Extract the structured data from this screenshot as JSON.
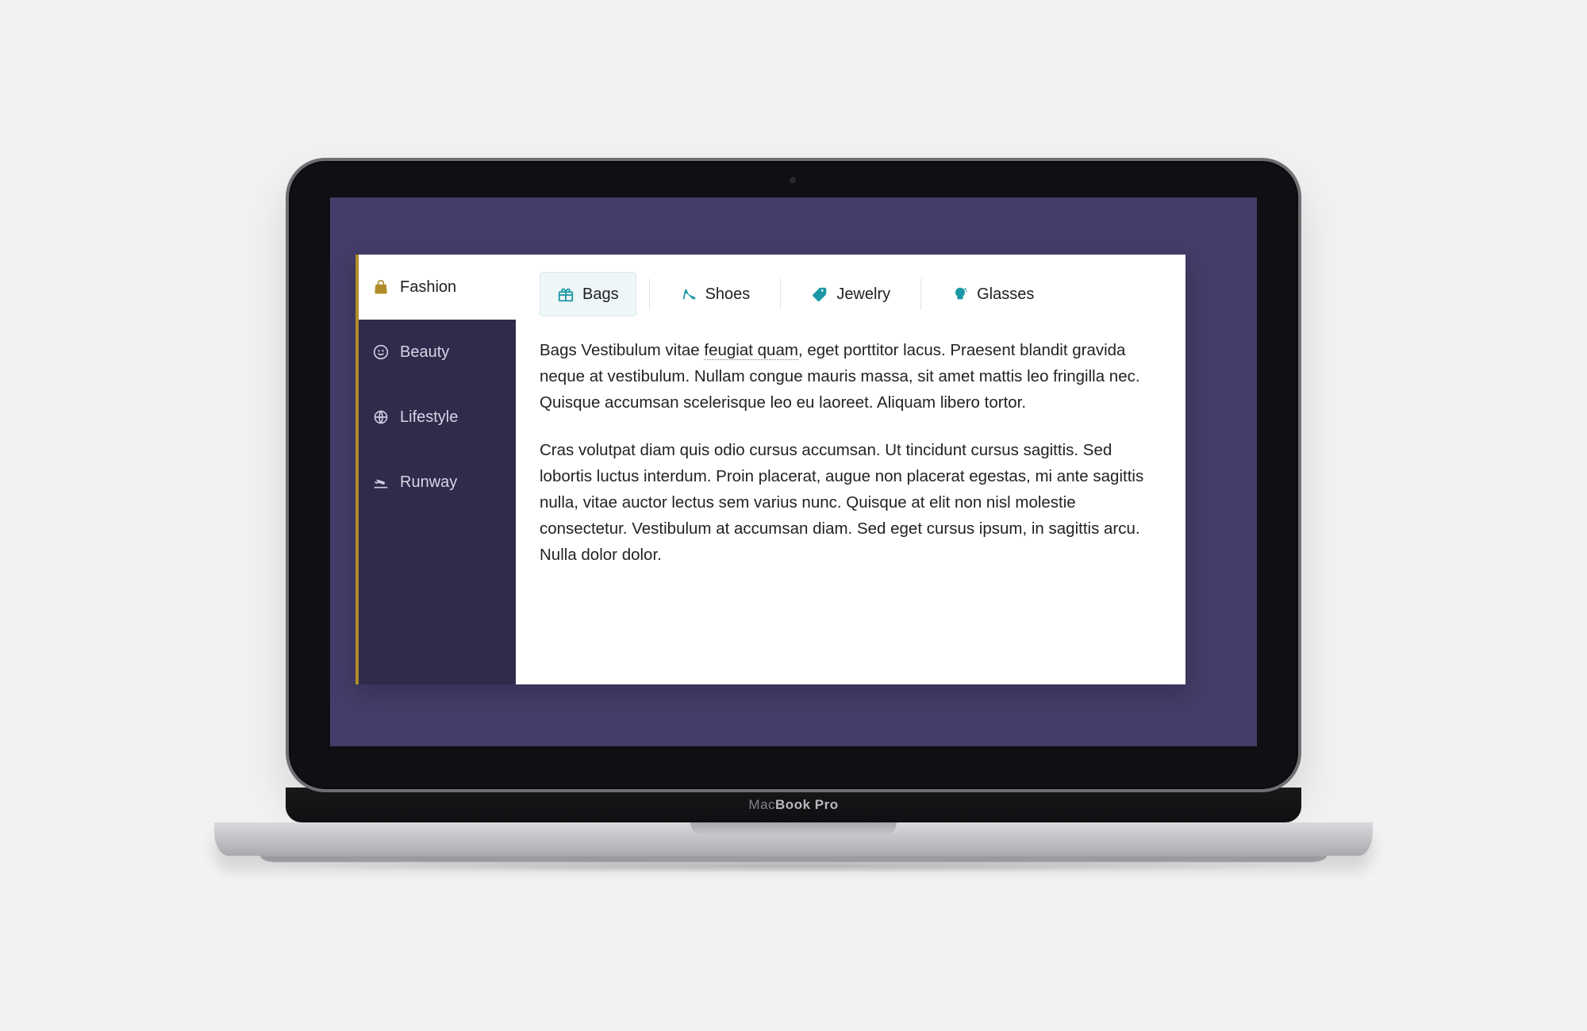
{
  "device": {
    "label_html": "Mac<b>Book Pro</b>"
  },
  "icons": {
    "bag": "bag-icon",
    "face": "face-icon",
    "globe": "globe-icon",
    "plane": "plane-takeoff-icon",
    "gift": "gift-icon",
    "shoe": "high-heel-icon",
    "tag": "tag-icon",
    "bulb": "lightbulb-icon"
  },
  "colors": {
    "page_bg": "#433d69",
    "sidebar_bg": "#2e2b4b",
    "accent_gold": "#b08d2a",
    "accent_teal": "#1c97a5",
    "tab_active_bg": "#eef6f8"
  },
  "sidebar": {
    "items": [
      {
        "label": "Fashion",
        "icon": "bag",
        "active": true
      },
      {
        "label": "Beauty",
        "icon": "face",
        "active": false
      },
      {
        "label": "Lifestyle",
        "icon": "globe",
        "active": false
      },
      {
        "label": "Runway",
        "icon": "plane",
        "active": false
      }
    ]
  },
  "tabs": {
    "items": [
      {
        "label": "Bags",
        "icon": "gift",
        "active": true
      },
      {
        "label": "Shoes",
        "icon": "shoe",
        "active": false
      },
      {
        "label": "Jewelry",
        "icon": "tag",
        "active": false
      },
      {
        "label": "Glasses",
        "icon": "bulb",
        "active": false
      }
    ]
  },
  "content": {
    "p1_lead": "Bags Vestibulum vitae ",
    "p1_underlined": "feugiat quam",
    "p1_rest": ", eget porttitor lacus. Praesent blandit gravida neque at vestibulum. Nullam congue mauris massa, sit amet mattis leo fringilla nec. Quisque accumsan scelerisque leo eu laoreet. Aliquam libero tortor.",
    "p2": "Cras volutpat diam quis odio cursus accumsan. Ut tincidunt cursus sagittis. Sed lobortis luctus interdum. Proin placerat, augue non placerat egestas, mi ante sagittis nulla, vitae auctor lectus sem varius nunc. Quisque at elit non nisl molestie consectetur. Vestibulum at accumsan diam. Sed eget cursus ipsum, in sagittis arcu. Nulla dolor dolor."
  }
}
